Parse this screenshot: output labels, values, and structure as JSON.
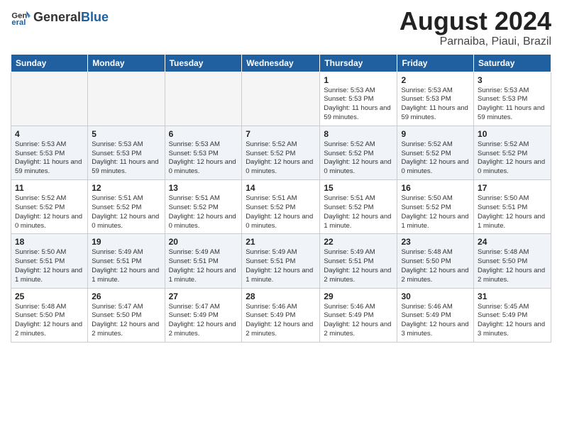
{
  "header": {
    "logo_general": "General",
    "logo_blue": "Blue",
    "month_year": "August 2024",
    "location": "Parnaiba, Piaui, Brazil"
  },
  "weekdays": [
    "Sunday",
    "Monday",
    "Tuesday",
    "Wednesday",
    "Thursday",
    "Friday",
    "Saturday"
  ],
  "weeks": [
    [
      {
        "day": "",
        "info": ""
      },
      {
        "day": "",
        "info": ""
      },
      {
        "day": "",
        "info": ""
      },
      {
        "day": "",
        "info": ""
      },
      {
        "day": "1",
        "info": "Sunrise: 5:53 AM\nSunset: 5:53 PM\nDaylight: 11 hours and 59 minutes."
      },
      {
        "day": "2",
        "info": "Sunrise: 5:53 AM\nSunset: 5:53 PM\nDaylight: 11 hours and 59 minutes."
      },
      {
        "day": "3",
        "info": "Sunrise: 5:53 AM\nSunset: 5:53 PM\nDaylight: 11 hours and 59 minutes."
      }
    ],
    [
      {
        "day": "4",
        "info": "Sunrise: 5:53 AM\nSunset: 5:53 PM\nDaylight: 11 hours and 59 minutes."
      },
      {
        "day": "5",
        "info": "Sunrise: 5:53 AM\nSunset: 5:53 PM\nDaylight: 11 hours and 59 minutes."
      },
      {
        "day": "6",
        "info": "Sunrise: 5:53 AM\nSunset: 5:53 PM\nDaylight: 12 hours and 0 minutes."
      },
      {
        "day": "7",
        "info": "Sunrise: 5:52 AM\nSunset: 5:52 PM\nDaylight: 12 hours and 0 minutes."
      },
      {
        "day": "8",
        "info": "Sunrise: 5:52 AM\nSunset: 5:52 PM\nDaylight: 12 hours and 0 minutes."
      },
      {
        "day": "9",
        "info": "Sunrise: 5:52 AM\nSunset: 5:52 PM\nDaylight: 12 hours and 0 minutes."
      },
      {
        "day": "10",
        "info": "Sunrise: 5:52 AM\nSunset: 5:52 PM\nDaylight: 12 hours and 0 minutes."
      }
    ],
    [
      {
        "day": "11",
        "info": "Sunrise: 5:52 AM\nSunset: 5:52 PM\nDaylight: 12 hours and 0 minutes."
      },
      {
        "day": "12",
        "info": "Sunrise: 5:51 AM\nSunset: 5:52 PM\nDaylight: 12 hours and 0 minutes."
      },
      {
        "day": "13",
        "info": "Sunrise: 5:51 AM\nSunset: 5:52 PM\nDaylight: 12 hours and 0 minutes."
      },
      {
        "day": "14",
        "info": "Sunrise: 5:51 AM\nSunset: 5:52 PM\nDaylight: 12 hours and 0 minutes."
      },
      {
        "day": "15",
        "info": "Sunrise: 5:51 AM\nSunset: 5:52 PM\nDaylight: 12 hours and 1 minute."
      },
      {
        "day": "16",
        "info": "Sunrise: 5:50 AM\nSunset: 5:52 PM\nDaylight: 12 hours and 1 minute."
      },
      {
        "day": "17",
        "info": "Sunrise: 5:50 AM\nSunset: 5:51 PM\nDaylight: 12 hours and 1 minute."
      }
    ],
    [
      {
        "day": "18",
        "info": "Sunrise: 5:50 AM\nSunset: 5:51 PM\nDaylight: 12 hours and 1 minute."
      },
      {
        "day": "19",
        "info": "Sunrise: 5:49 AM\nSunset: 5:51 PM\nDaylight: 12 hours and 1 minute."
      },
      {
        "day": "20",
        "info": "Sunrise: 5:49 AM\nSunset: 5:51 PM\nDaylight: 12 hours and 1 minute."
      },
      {
        "day": "21",
        "info": "Sunrise: 5:49 AM\nSunset: 5:51 PM\nDaylight: 12 hours and 1 minute."
      },
      {
        "day": "22",
        "info": "Sunrise: 5:49 AM\nSunset: 5:51 PM\nDaylight: 12 hours and 2 minutes."
      },
      {
        "day": "23",
        "info": "Sunrise: 5:48 AM\nSunset: 5:50 PM\nDaylight: 12 hours and 2 minutes."
      },
      {
        "day": "24",
        "info": "Sunrise: 5:48 AM\nSunset: 5:50 PM\nDaylight: 12 hours and 2 minutes."
      }
    ],
    [
      {
        "day": "25",
        "info": "Sunrise: 5:48 AM\nSunset: 5:50 PM\nDaylight: 12 hours and 2 minutes."
      },
      {
        "day": "26",
        "info": "Sunrise: 5:47 AM\nSunset: 5:50 PM\nDaylight: 12 hours and 2 minutes."
      },
      {
        "day": "27",
        "info": "Sunrise: 5:47 AM\nSunset: 5:49 PM\nDaylight: 12 hours and 2 minutes."
      },
      {
        "day": "28",
        "info": "Sunrise: 5:46 AM\nSunset: 5:49 PM\nDaylight: 12 hours and 2 minutes."
      },
      {
        "day": "29",
        "info": "Sunrise: 5:46 AM\nSunset: 5:49 PM\nDaylight: 12 hours and 2 minutes."
      },
      {
        "day": "30",
        "info": "Sunrise: 5:46 AM\nSunset: 5:49 PM\nDaylight: 12 hours and 3 minutes."
      },
      {
        "day": "31",
        "info": "Sunrise: 5:45 AM\nSunset: 5:49 PM\nDaylight: 12 hours and 3 minutes."
      }
    ]
  ]
}
